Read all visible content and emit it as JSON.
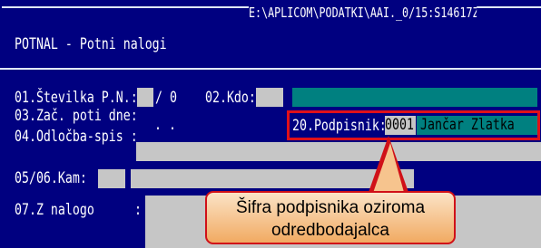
{
  "window": {
    "path": "E:\\APLICOM\\PODATKI\\AAI._0/15:S14617Z",
    "title": "POTNAL - Potni nalogi"
  },
  "form": {
    "field01_label": "01.Številka P.N.:",
    "field01_value": "/ 0",
    "field02_label": "02.Kdo:",
    "field03_label": "03.Zač. poti dne:",
    "field03_value": ".  .",
    "field04_label": "04.Odločba-spis :",
    "field05_label": "05/06.Kam:",
    "field07_label": "07.Z nalogo",
    "field07_colon": ":",
    "field20_label": "20.Podpisnik:",
    "field20_code": "0001",
    "field20_name": "Jančar Zlatka"
  },
  "callout": {
    "line1": "Šifra podpisnika oziroma",
    "line2": "odredbodajalca"
  },
  "colors": {
    "background": "#000080",
    "highlight": "#008080",
    "field": "#c6c6c6",
    "annotation_border": "#e0101a"
  }
}
